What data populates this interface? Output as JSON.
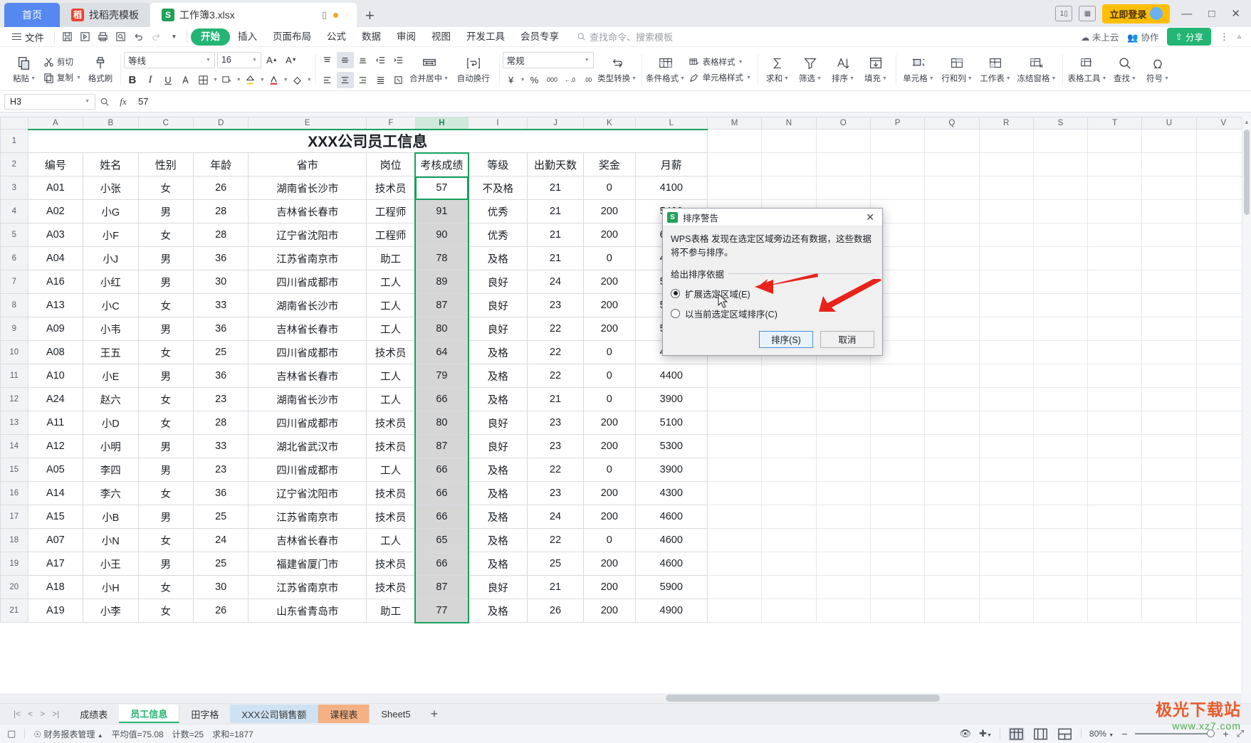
{
  "window": {
    "tabs": [
      {
        "label": "首页",
        "icon": "home-tab"
      },
      {
        "label": "找稻壳模板",
        "icon": "docer-icon"
      },
      {
        "label": "工作簿3.xlsx",
        "icon": "spreadsheet-icon"
      }
    ],
    "login_label": "立即登录",
    "add_tab": "+",
    "minimize": "—",
    "maximize": "□",
    "close": "✕"
  },
  "menu": {
    "file": "文件",
    "quick_icons": [
      "save-icon",
      "save-as-icon",
      "print-icon",
      "print-preview-icon",
      "undo-icon",
      "redo-icon",
      "customize-icon"
    ],
    "items": [
      "开始",
      "插入",
      "页面布局",
      "公式",
      "数据",
      "审阅",
      "视图",
      "开发工具",
      "会员专享"
    ],
    "selected": "开始",
    "search_placeholder": "查找命令、搜索模板",
    "cloud_status": "未上云",
    "collab": "协作",
    "share": "分享"
  },
  "ribbon": {
    "clipboard": {
      "paste": "粘贴",
      "cut": "剪切",
      "copy": "复制",
      "format_painter": "格式刷"
    },
    "font": {
      "name": "等线",
      "size": "16",
      "grow": "A↑",
      "shrink": "A↓",
      "bold": "B",
      "italic": "I",
      "underline": "U",
      "strike": "A",
      "border": "border-icon",
      "fill": "fill-icon",
      "font_color": "font-color-icon",
      "eraser": "eraser-icon"
    },
    "align": {
      "merge_center": "合并居中",
      "wrap_text": "自动换行"
    },
    "number": {
      "format": "常规",
      "currency": "¥",
      "percent": "%",
      "comma": "000",
      "dec_less": "←.0",
      "dec_more": ".00",
      "type_convert": "类型转换"
    },
    "styles": {
      "conditional": "条件格式",
      "table_style": "表格样式",
      "cell_style": "单元格样式"
    },
    "editing": {
      "sum": "求和",
      "filter": "筛选",
      "sort": "排序",
      "fill": "填充"
    },
    "cells": {
      "cell": "单元格",
      "rows_cols": "行和列",
      "worksheet": "工作表",
      "freeze": "冻结窗格"
    },
    "tools": {
      "table_tools": "表格工具",
      "find": "查找",
      "symbol": "符号"
    }
  },
  "formula_bar": {
    "name_box": "H3",
    "fx_label": "fx",
    "value": "57",
    "zoom_icon": "magnifier-icon"
  },
  "sheet": {
    "column_headers": [
      "A",
      "B",
      "C",
      "D",
      "E",
      "F",
      "H",
      "I",
      "J",
      "K",
      "L",
      "M",
      "N",
      "O",
      "P",
      "Q",
      "R",
      "S",
      "T",
      "U",
      "V"
    ],
    "selected_column": "H",
    "active_cell": "H3",
    "title_row": {
      "row": "1",
      "title": "XXX公司员工信息"
    },
    "header_row": {
      "row": "2",
      "cells": [
        "编号",
        "姓名",
        "性别",
        "年龄",
        "省市",
        "岗位",
        "考核成绩",
        "等级",
        "出勤天数",
        "奖金",
        "月薪"
      ]
    },
    "rows": [
      {
        "row": "3",
        "cells": [
          "A01",
          "小张",
          "女",
          "26",
          "湖南省长沙市",
          "技术员",
          "57",
          "不及格",
          "21",
          "0",
          "4100"
        ]
      },
      {
        "row": "4",
        "cells": [
          "A02",
          "小G",
          "男",
          "28",
          "吉林省长春市",
          "工程师",
          "91",
          "优秀",
          "21",
          "200",
          "5400"
        ]
      },
      {
        "row": "5",
        "cells": [
          "A03",
          "小F",
          "女",
          "28",
          "辽宁省沈阳市",
          "工程师",
          "90",
          "优秀",
          "21",
          "200",
          "6000"
        ]
      },
      {
        "row": "6",
        "cells": [
          "A04",
          "小J",
          "男",
          "36",
          "江苏省南京市",
          "助工",
          "78",
          "及格",
          "21",
          "0",
          "4500"
        ]
      },
      {
        "row": "7",
        "cells": [
          "A16",
          "小红",
          "男",
          "30",
          "四川省成都市",
          "工人",
          "89",
          "良好",
          "24",
          "200",
          "5200"
        ]
      },
      {
        "row": "8",
        "cells": [
          "A13",
          "小C",
          "女",
          "33",
          "湖南省长沙市",
          "工人",
          "87",
          "良好",
          "23",
          "200",
          "5000"
        ]
      },
      {
        "row": "9",
        "cells": [
          "A09",
          "小韦",
          "男",
          "36",
          "吉林省长春市",
          "工人",
          "80",
          "良好",
          "22",
          "200",
          "5100"
        ]
      },
      {
        "row": "10",
        "cells": [
          "A08",
          "王五",
          "女",
          "25",
          "四川省成都市",
          "技术员",
          "64",
          "及格",
          "22",
          "0",
          "4300"
        ]
      },
      {
        "row": "11",
        "cells": [
          "A10",
          "小E",
          "男",
          "36",
          "吉林省长春市",
          "工人",
          "79",
          "及格",
          "22",
          "0",
          "4400"
        ]
      },
      {
        "row": "12",
        "cells": [
          "A24",
          "赵六",
          "女",
          "23",
          "湖南省长沙市",
          "工人",
          "66",
          "及格",
          "21",
          "0",
          "3900"
        ]
      },
      {
        "row": "13",
        "cells": [
          "A11",
          "小D",
          "女",
          "28",
          "四川省成都市",
          "技术员",
          "80",
          "良好",
          "23",
          "200",
          "5100"
        ]
      },
      {
        "row": "14",
        "cells": [
          "A12",
          "小明",
          "男",
          "33",
          "湖北省武汉市",
          "技术员",
          "87",
          "良好",
          "23",
          "200",
          "5300"
        ]
      },
      {
        "row": "15",
        "cells": [
          "A05",
          "李四",
          "男",
          "23",
          "四川省成都市",
          "工人",
          "66",
          "及格",
          "22",
          "0",
          "3900"
        ]
      },
      {
        "row": "16",
        "cells": [
          "A14",
          "李六",
          "女",
          "36",
          "辽宁省沈阳市",
          "技术员",
          "66",
          "及格",
          "23",
          "200",
          "4300"
        ]
      },
      {
        "row": "17",
        "cells": [
          "A15",
          "小B",
          "男",
          "25",
          "江苏省南京市",
          "技术员",
          "66",
          "及格",
          "24",
          "200",
          "4600"
        ]
      },
      {
        "row": "18",
        "cells": [
          "A07",
          "小N",
          "女",
          "24",
          "吉林省长春市",
          "工人",
          "65",
          "及格",
          "22",
          "0",
          "4600"
        ]
      },
      {
        "row": "19",
        "cells": [
          "A17",
          "小王",
          "男",
          "25",
          "福建省厦门市",
          "技术员",
          "66",
          "及格",
          "25",
          "200",
          "4600"
        ]
      },
      {
        "row": "20",
        "cells": [
          "A18",
          "小H",
          "女",
          "30",
          "江苏省南京市",
          "技术员",
          "87",
          "良好",
          "21",
          "200",
          "5900"
        ]
      },
      {
        "row": "21",
        "cells": [
          "A19",
          "小李",
          "女",
          "26",
          "山东省青岛市",
          "助工",
          "77",
          "及格",
          "26",
          "200",
          "4900"
        ]
      }
    ]
  },
  "dialog": {
    "title": "排序警告",
    "message": "WPS表格 发现在选定区域旁边还有数据，这些数据将不参与排序。",
    "legend": "给出排序依据",
    "option_expand": "扩展选定区域(E)",
    "option_current": "以当前选定区域排序(C)",
    "selected_option": "expand",
    "btn_sort": "排序(S)",
    "btn_cancel": "取消",
    "close": "✕"
  },
  "sheet_tabs": {
    "nav": [
      "|<",
      "<",
      ">",
      ">|"
    ],
    "items": [
      {
        "label": "成绩表",
        "style": "plain"
      },
      {
        "label": "员工信息",
        "style": "active"
      },
      {
        "label": "田字格",
        "style": "plain"
      },
      {
        "label": "XXX公司销售额",
        "style": "blue"
      },
      {
        "label": "课程表",
        "style": "orange"
      },
      {
        "label": "Sheet5",
        "style": "plain"
      }
    ],
    "add": "+"
  },
  "status_bar": {
    "mode_icon": "js-icon",
    "report_label": "财务报表管理",
    "average": "平均值=75.08",
    "count": "计数=25",
    "sum": "求和=1877",
    "eye_icon": "eye-icon",
    "fit_icon": "fit-icon",
    "views": [
      "normal-view",
      "page-layout-view",
      "page-break-view"
    ],
    "zoom": "80%",
    "minus": "−",
    "plus": "+"
  },
  "watermark": {
    "line1": "极光下载站",
    "line2": "www.xz7.com"
  }
}
